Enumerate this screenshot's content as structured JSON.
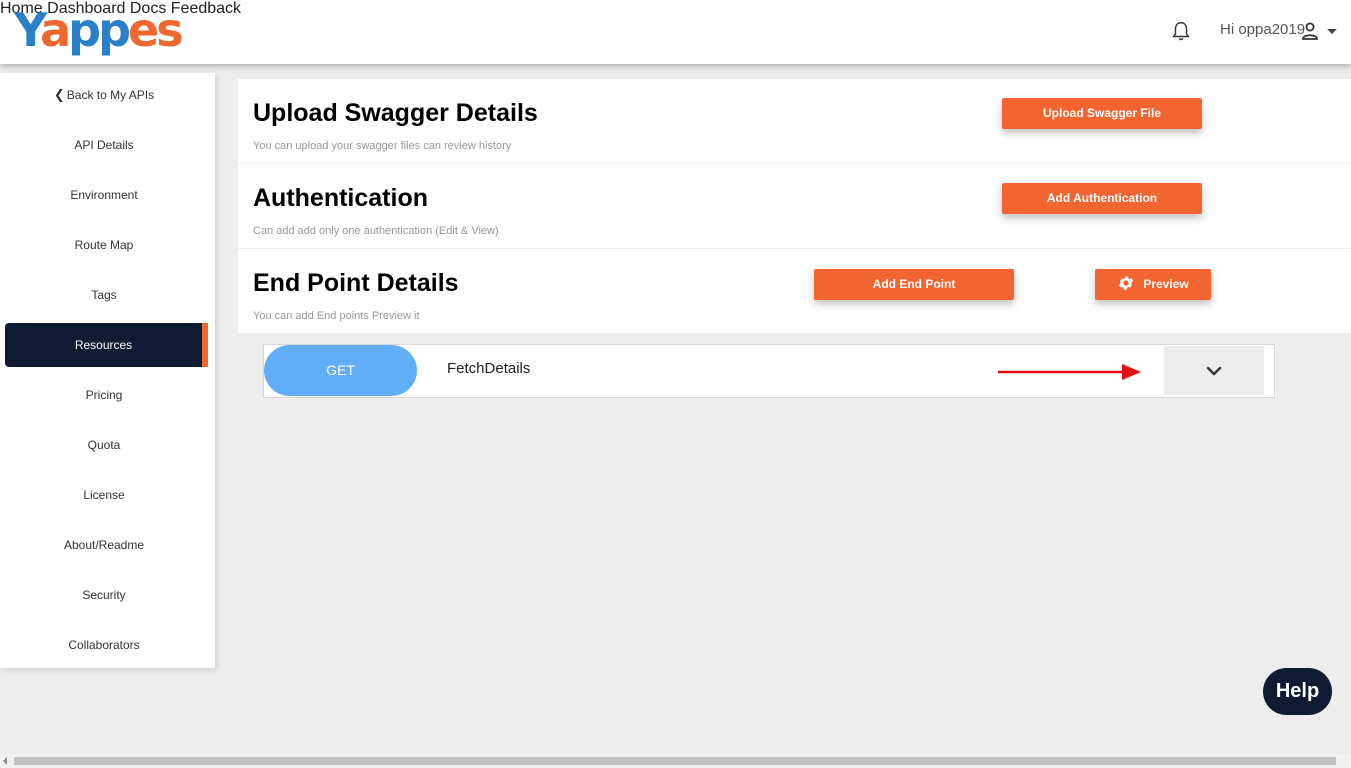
{
  "header": {
    "logo_text": "Yappes",
    "nav": [
      "Home",
      "Dashboard",
      "Docs",
      "Feedback"
    ],
    "user_greeting": "Hi oppa2019"
  },
  "sidebar": {
    "back_label": "Back to My APIs",
    "items": [
      "API Details",
      "Environment",
      "Route Map",
      "Tags",
      "Resources",
      "Pricing",
      "Quota",
      "License",
      "About/Readme",
      "Security",
      "Collaborators"
    ],
    "active": "Resources"
  },
  "sections": {
    "swagger": {
      "title": "Upload Swagger Details",
      "subtitle": "You can upload your swagger files can review history",
      "button": "Upload Swagger File"
    },
    "auth": {
      "title": "Authentication",
      "subtitle": "Can add add only one authentication (Edit & View)",
      "button": "Add Authentication"
    },
    "endpoints": {
      "title": "End Point Details",
      "subtitle": "You can add End points Preview it",
      "add_button": "Add End Point",
      "preview_button": "Preview"
    }
  },
  "endpoint_list": [
    {
      "method": "GET",
      "name": "FetchDetails"
    }
  ],
  "help_label": "Help",
  "colors": {
    "accent": "#f26530",
    "navy": "#0f1b33",
    "method_get": "#62adf7",
    "annotation_arrow": "#e01010"
  }
}
